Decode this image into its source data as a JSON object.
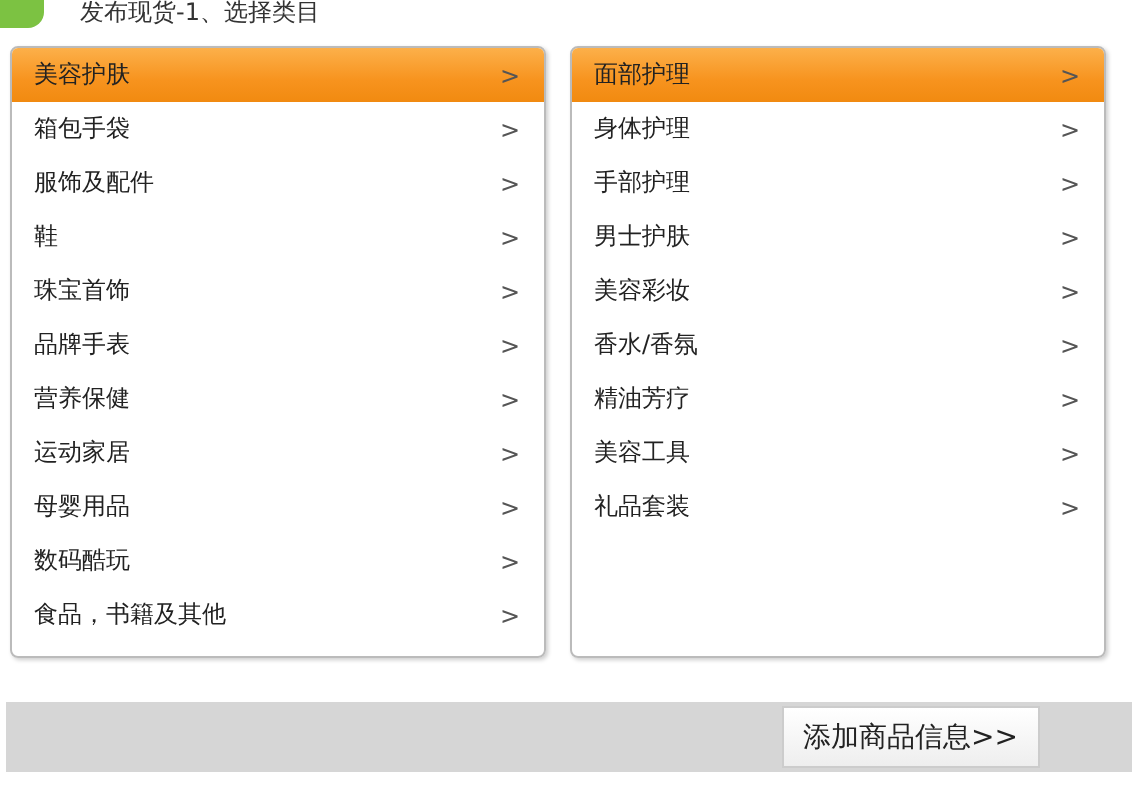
{
  "header": {
    "title": "发布现货-1、选择类目"
  },
  "categories": [
    {
      "label": "美容护肤",
      "arrow": ">",
      "selected": true
    },
    {
      "label": "箱包手袋",
      "arrow": ">",
      "selected": false
    },
    {
      "label": "服饰及配件",
      "arrow": ">",
      "selected": false
    },
    {
      "label": "鞋",
      "arrow": ">",
      "selected": false
    },
    {
      "label": "珠宝首饰",
      "arrow": ">",
      "selected": false
    },
    {
      "label": "品牌手表",
      "arrow": ">",
      "selected": false
    },
    {
      "label": "营养保健",
      "arrow": ">",
      "selected": false
    },
    {
      "label": "运动家居",
      "arrow": ">",
      "selected": false
    },
    {
      "label": "母婴用品",
      "arrow": ">",
      "selected": false
    },
    {
      "label": "数码酷玩",
      "arrow": ">",
      "selected": false
    },
    {
      "label": "食品，书籍及其他",
      "arrow": ">",
      "selected": false
    }
  ],
  "subcategories": [
    {
      "label": "面部护理",
      "arrow": ">",
      "selected": true
    },
    {
      "label": "身体护理",
      "arrow": ">",
      "selected": false
    },
    {
      "label": "手部护理",
      "arrow": ">",
      "selected": false
    },
    {
      "label": "男士护肤",
      "arrow": ">",
      "selected": false
    },
    {
      "label": "美容彩妆",
      "arrow": ">",
      "selected": false
    },
    {
      "label": "香水/香氛",
      "arrow": ">",
      "selected": false
    },
    {
      "label": "精油芳疗",
      "arrow": ">",
      "selected": false
    },
    {
      "label": "美容工具",
      "arrow": ">",
      "selected": false
    },
    {
      "label": "礼品套装",
      "arrow": ">",
      "selected": false
    }
  ],
  "footer": {
    "button": "添加商品信息>>"
  }
}
